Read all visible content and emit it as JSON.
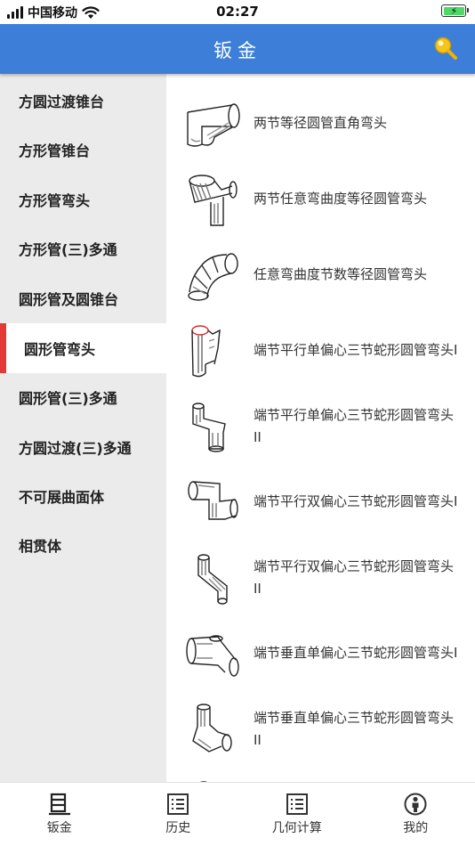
{
  "status_bar": {
    "carrier": "中国移动",
    "time": "02:27",
    "battery_charging": true
  },
  "nav": {
    "title": "钣金",
    "search_icon": "magnifier-icon",
    "search_color": "#f4c51c"
  },
  "colors": {
    "accent": "#3d7fd8",
    "active_marker": "#e53935",
    "sidebar_bg": "#ebebeb"
  },
  "sidebar": {
    "items": [
      {
        "label": "方圆过渡锥台",
        "active": false
      },
      {
        "label": "方形管锥台",
        "active": false
      },
      {
        "label": "方形管弯头",
        "active": false
      },
      {
        "label": "方形管(三)多通",
        "active": false
      },
      {
        "label": "圆形管及圆锥台",
        "active": false
      },
      {
        "label": "圆形管弯头",
        "active": true
      },
      {
        "label": "圆形管(三)多通",
        "active": false
      },
      {
        "label": "方圆过渡(三)多通",
        "active": false
      },
      {
        "label": "不可展曲面体",
        "active": false
      },
      {
        "label": "相贯体",
        "active": false
      }
    ]
  },
  "list": {
    "items": [
      {
        "label": "两节等径圆管直角弯头",
        "icon": "two-segment-elbow-icon"
      },
      {
        "label": "两节任意弯曲度等径圆管弯头",
        "icon": "angled-elbow-icon"
      },
      {
        "label": "任意弯曲度节数等径圆管弯头",
        "icon": "multi-segment-elbow-icon"
      },
      {
        "label": "端节平行单偏心三节蛇形圆管弯头I",
        "icon": "snake-pipe-icon"
      },
      {
        "label": "端节平行单偏心三节蛇形圆管弯头II",
        "icon": "snake-pipe-icon"
      },
      {
        "label": "端节平行双偏心三节蛇形圆管弯头I",
        "icon": "snake-pipe-icon"
      },
      {
        "label": "端节平行双偏心三节蛇形圆管弯头II",
        "icon": "snake-pipe-icon"
      },
      {
        "label": "端节垂直单偏心三节蛇形圆管弯头I",
        "icon": "snake-pipe-icon"
      },
      {
        "label": "端节垂直单偏心三节蛇形圆管弯头II",
        "icon": "snake-pipe-icon"
      }
    ]
  },
  "tabs": [
    {
      "label": "钣金",
      "icon": "sheet-metal-icon"
    },
    {
      "label": "历史",
      "icon": "history-list-icon"
    },
    {
      "label": "几何计算",
      "icon": "geometry-list-icon"
    },
    {
      "label": "我的",
      "icon": "profile-icon"
    }
  ]
}
